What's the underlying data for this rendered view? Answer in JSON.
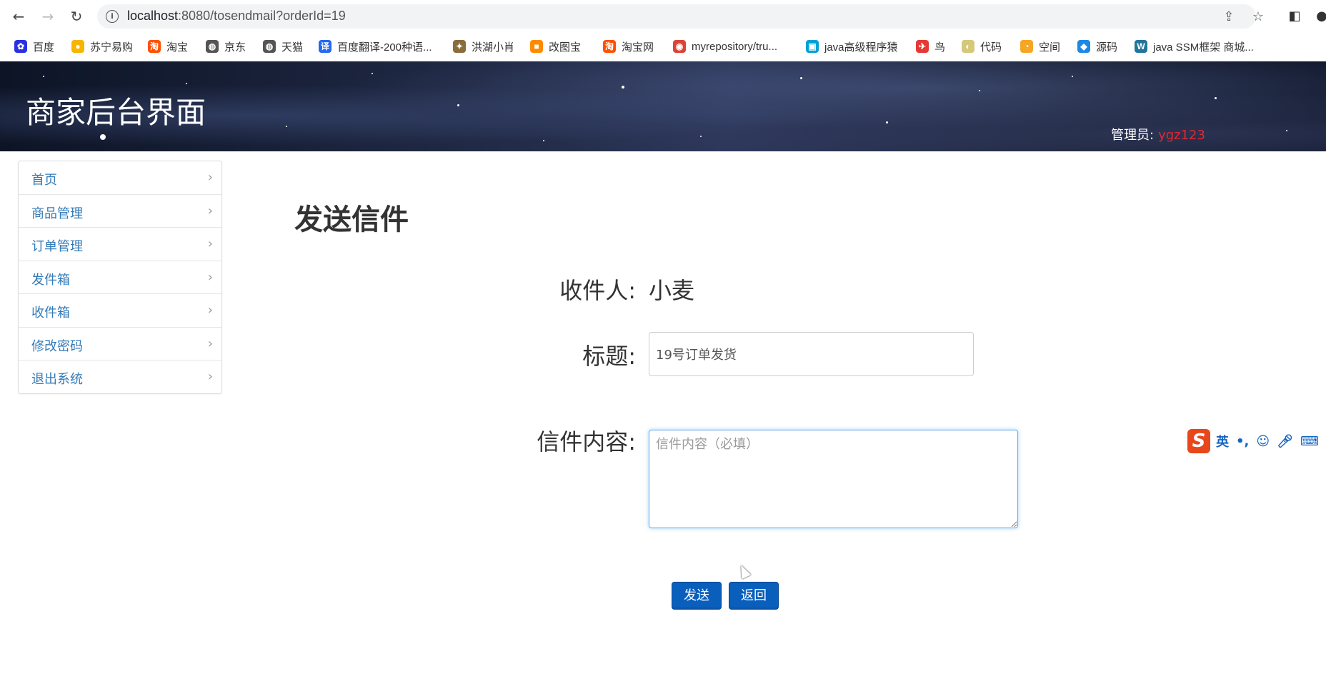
{
  "browser": {
    "url_host": "localhost",
    "url_rest": ":8080/tosendmail?orderId=19",
    "bookmarks": [
      {
        "label": "百度",
        "color": "#2932e1",
        "glyph": "✿"
      },
      {
        "label": "苏宁易购",
        "color": "#f7b500",
        "glyph": "●"
      },
      {
        "label": "淘宝",
        "color": "#ff5000",
        "glyph": "淘"
      },
      {
        "label": "京东",
        "color": "#555555",
        "glyph": "◍"
      },
      {
        "label": "天猫",
        "color": "#555555",
        "glyph": "◍"
      },
      {
        "label": "百度翻译-200种语...",
        "color": "#2468f2",
        "glyph": "译"
      },
      {
        "label": "洪湖小肖",
        "color": "#8a6d3b",
        "glyph": "✦"
      },
      {
        "label": "改图宝",
        "color": "#ff8a00",
        "glyph": "■"
      },
      {
        "label": "淘宝网",
        "color": "#ff5000",
        "glyph": "淘"
      },
      {
        "label": "myrepository/tru...",
        "color": "#db4437",
        "glyph": "◉"
      },
      {
        "label": "java高级程序猿",
        "color": "#00a1d6",
        "glyph": "▣"
      },
      {
        "label": "鸟",
        "color": "#e53935",
        "glyph": "✈"
      },
      {
        "label": "代码",
        "color": "#d4c97a",
        "glyph": "◐"
      },
      {
        "label": "空间",
        "color": "#f5a623",
        "glyph": "◔"
      },
      {
        "label": "源码",
        "color": "#1e88e5",
        "glyph": "◆"
      },
      {
        "label": "java SSM框架 商城...",
        "color": "#21759b",
        "glyph": "W"
      }
    ]
  },
  "header": {
    "title": "商家后台界面",
    "admin_label": "管理员:",
    "admin_name": "ygz123"
  },
  "sidebar": {
    "items": [
      {
        "label": "首页"
      },
      {
        "label": "商品管理"
      },
      {
        "label": "订单管理"
      },
      {
        "label": "发件箱"
      },
      {
        "label": "收件箱"
      },
      {
        "label": "修改密码"
      },
      {
        "label": "退出系统"
      }
    ]
  },
  "form": {
    "page_title": "发送信件",
    "recipient_label": "收件人:",
    "recipient_value": "小麦",
    "subject_label": "标题:",
    "subject_value": "19号订单发货",
    "content_label": "信件内容:",
    "content_placeholder": "信件内容（必填）",
    "send_label": "发送",
    "back_label": "返回"
  },
  "ime": {
    "logo": "S",
    "lang": "英"
  },
  "colors": {
    "link": "#337ab7",
    "button": "#0a5fbd",
    "admin_name": "#e3272f"
  }
}
